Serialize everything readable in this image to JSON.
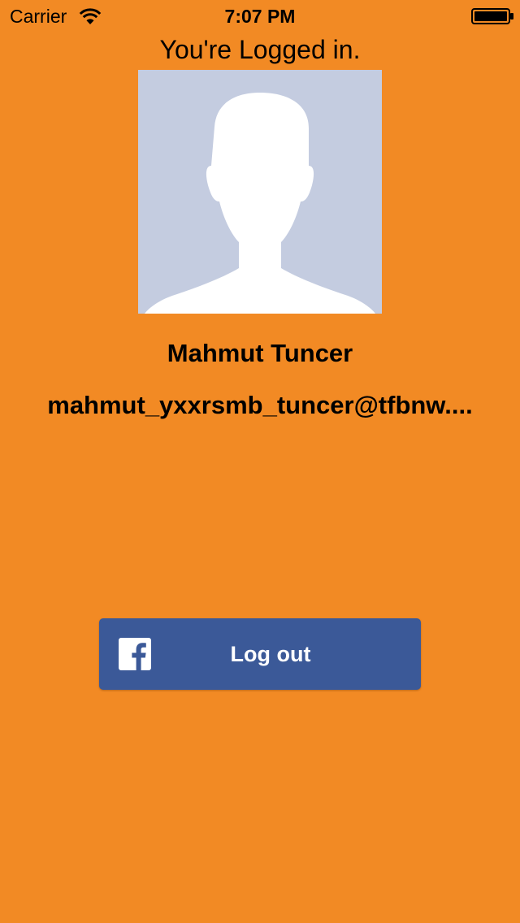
{
  "status_bar": {
    "carrier": "Carrier",
    "time": "7:07 PM",
    "wifi_icon": "wifi-icon",
    "battery_icon": "battery-icon"
  },
  "main": {
    "title": "You're Logged in.",
    "avatar_icon": "default-profile-silhouette-icon",
    "user_name": "Mahmut Tuncer",
    "user_email": "mahmut_yxxrsmb_tuncer@tfbnw...."
  },
  "logout_button": {
    "icon": "facebook-icon",
    "label": "Log out"
  },
  "colors": {
    "background": "#F28A24",
    "avatar_background": "#C4CCE0",
    "facebook_blue": "#3B5998",
    "text": "#000000",
    "button_text": "#FFFFFF"
  }
}
